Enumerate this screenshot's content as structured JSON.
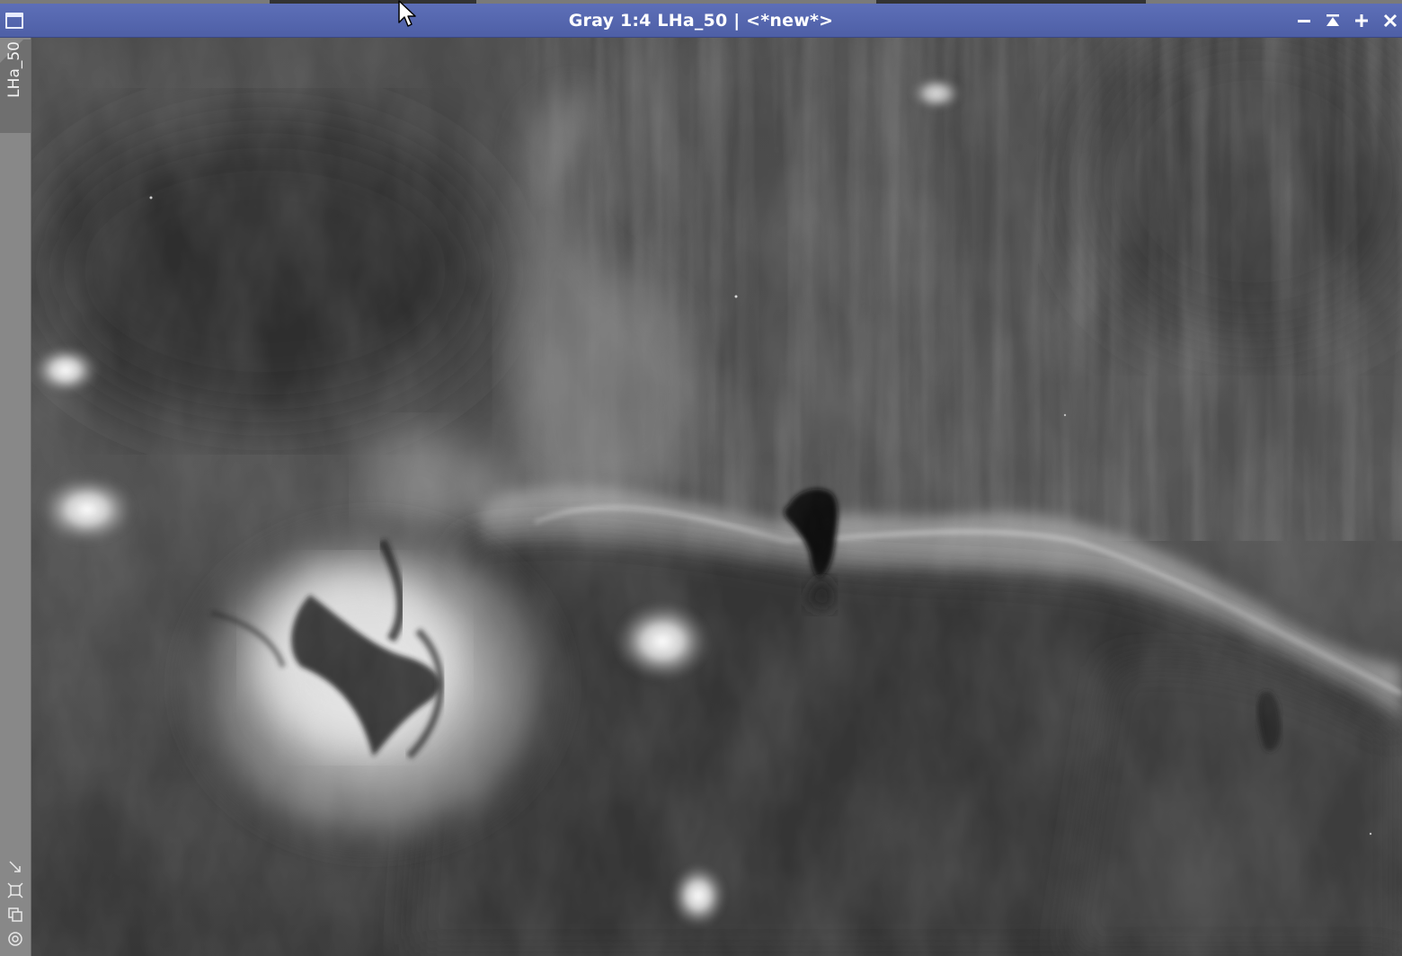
{
  "window": {
    "title": "Gray 1:4 LHa_50 | <*new*>",
    "controls": [
      {
        "name": "minimize-button",
        "icon": "minimize-icon"
      },
      {
        "name": "shade-button",
        "icon": "shade-icon"
      },
      {
        "name": "maximize-button",
        "icon": "maximize-icon"
      },
      {
        "name": "close-button",
        "icon": "close-icon"
      }
    ]
  },
  "view": {
    "tab_label": "LHa_50",
    "image_alt": "Horsehead and Flame Nebula H-alpha grayscale image"
  },
  "sidebar_tools": [
    {
      "name": "zoom-to-fit-icon"
    },
    {
      "name": "fit-view-icon"
    },
    {
      "name": "clone-view-icon"
    },
    {
      "name": "preview-icon"
    }
  ],
  "colors": {
    "titlebar": "#5564ad",
    "sidebar": "#888888",
    "tab": "#6f6f6f"
  }
}
